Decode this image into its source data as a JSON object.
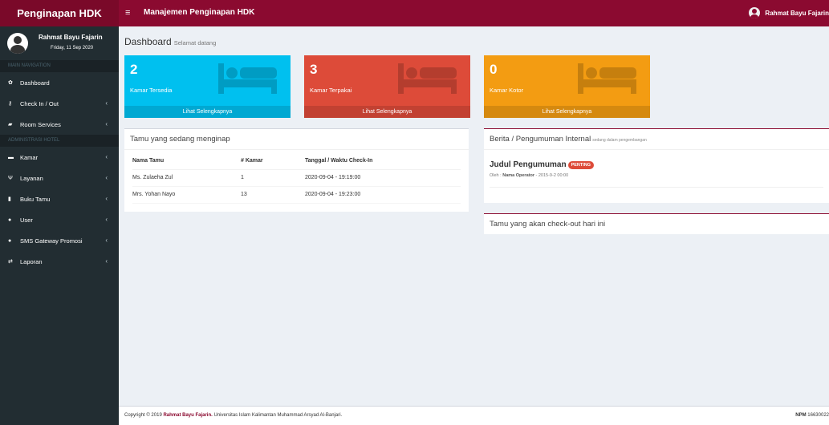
{
  "brand": "Penginapan HDK",
  "topbar": {
    "menu_icon": "hamburger-icon",
    "title": "Manajemen Penginapan HDK",
    "user_name": "Rahmat Bayu Fajarin"
  },
  "sidebar": {
    "user_name": "Rahmat Bayu Fajarin",
    "date": "Friday, 11 Sep 2020",
    "header_main": "MAIN NAVIGATION",
    "header_admin": "ADMINISTRASI HOTEL",
    "items": [
      {
        "label": "Dashboard",
        "icon": "dashboard-icon",
        "glyph": "✿",
        "chevron": false
      },
      {
        "label": "Check In / Out",
        "icon": "key-icon",
        "glyph": "⚷",
        "chevron": true
      },
      {
        "label": "Room Services",
        "icon": "book-icon",
        "glyph": "▰",
        "chevron": true
      },
      {
        "label": "Kamar",
        "icon": "bed-icon",
        "glyph": "▬",
        "chevron": true
      },
      {
        "label": "Layanan",
        "icon": "cutlery-icon",
        "glyph": "Ψ",
        "chevron": true
      },
      {
        "label": "Buku Tamu",
        "icon": "book-icon",
        "glyph": "▮",
        "chevron": true
      },
      {
        "label": "User",
        "icon": "user-icon",
        "glyph": "●",
        "chevron": true
      },
      {
        "label": "SMS Gateway Promosi",
        "icon": "user-icon",
        "glyph": "●",
        "chevron": true
      },
      {
        "label": "Laporan",
        "icon": "exchange-icon",
        "glyph": "⇄",
        "chevron": true
      }
    ],
    "chevron": "‹"
  },
  "content": {
    "title": "Dashboard",
    "subtitle": "Selamat datang"
  },
  "boxes": [
    {
      "number": "2",
      "label": "Kamar Tersedia",
      "more": "Lihat Selengkapnya",
      "color": "#00c0ef"
    },
    {
      "number": "3",
      "label": "Kamar Terpakai",
      "more": "Lihat Selengkapnya",
      "color": "#dd4b39"
    },
    {
      "number": "0",
      "label": "Kamar Kotor",
      "more": "Lihat Selengkapnya",
      "color": "#f39c12"
    }
  ],
  "guests": {
    "title": "Tamu yang sedang menginap",
    "columns": [
      "Nama Tamu",
      "# Kamar",
      "Tanggal / Waktu Check-In"
    ],
    "rows": [
      [
        "Ms. Zulaeha Zul",
        "1",
        "2020-09-04 - 19:19:00"
      ],
      [
        "Mrs. Yohan Nayo",
        "13",
        "2020-09-04 - 19:23:00"
      ]
    ]
  },
  "news": {
    "title": "Berita / Pengumuman Internal",
    "subtitle": "sedang dalam pengembangan",
    "item_title": "Judul Pengumuman",
    "badge": "PENTING",
    "by_label": "Oleh :",
    "operator": "Nama Operator",
    "date": "- 2015-9-2 00:00"
  },
  "checkout": {
    "title": "Tamu yang akan check-out hari ini"
  },
  "footer": {
    "prefix": "Copyright © 2019",
    "author": "Rahmat Bayu Fajarin.",
    "institution": "Universitas Islam Kalimantan Muhammad Arsyad Al-Banjari.",
    "npm_label": "NPM",
    "npm": "16630022"
  },
  "colors": {
    "brand": "#8b0a30",
    "sidebar": "#222d32",
    "aqua": "#00c0ef",
    "red": "#dd4b39",
    "yellow": "#f39c12"
  }
}
